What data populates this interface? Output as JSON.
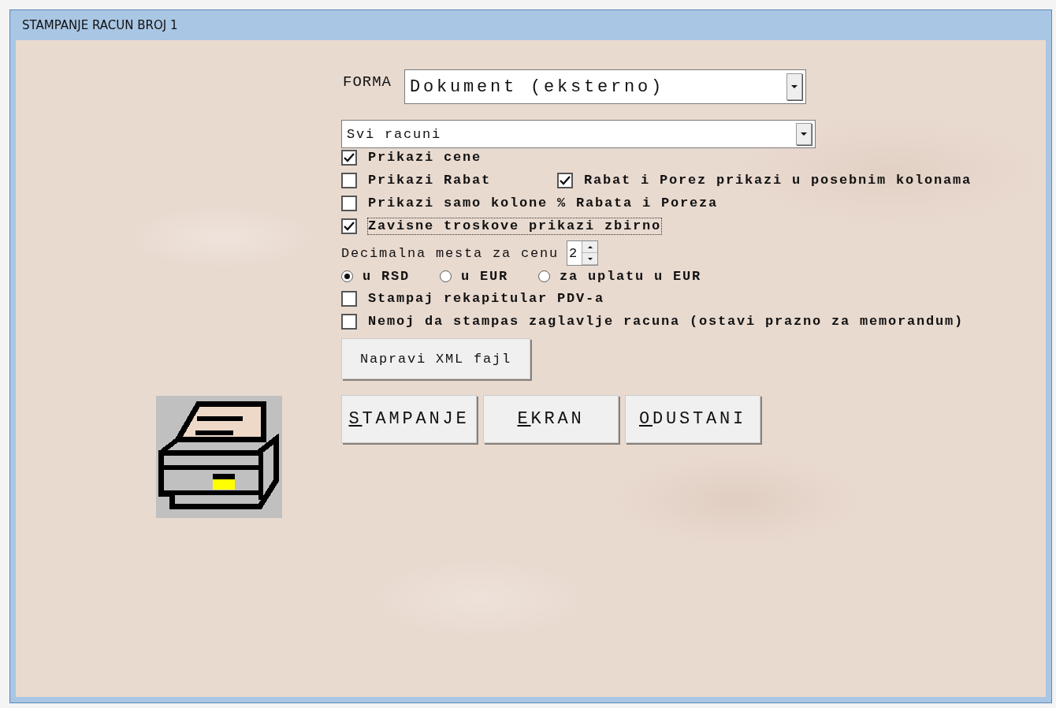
{
  "window": {
    "title": "STAMPANJE RACUN BROJ 1"
  },
  "forma": {
    "label": "FORMA",
    "value": "Dokument (eksterno)"
  },
  "filter": {
    "value": "Svi racuni"
  },
  "option_rows": [
    [
      {
        "label": "Prikazi cene",
        "checked": true,
        "focused": false
      }
    ],
    [
      {
        "label": "Prikazi Rabat",
        "checked": false,
        "focused": false
      },
      {
        "label": "Rabat i Porez prikazi u posebnim kolonama",
        "checked": true,
        "focused": false
      }
    ],
    [
      {
        "label": "Prikazi samo kolone % Rabata i Poreza",
        "checked": false,
        "focused": false
      }
    ],
    [
      {
        "label": "Zavisne troskove prikazi zbirno",
        "checked": true,
        "focused": true
      }
    ]
  ],
  "decimals": {
    "label": "Decimalna mesta za cenu",
    "value": "2"
  },
  "currency": [
    {
      "label": "u RSD",
      "selected": true
    },
    {
      "label": "u EUR",
      "selected": false
    },
    {
      "label": "za uplatu u EUR",
      "selected": false
    }
  ],
  "print_options": [
    {
      "label": "Stampaj rekapitular PDV-a",
      "checked": false
    },
    {
      "label": "Nemoj da stampas zaglavlje racuna (ostavi prazno za memorandum)",
      "checked": false
    }
  ],
  "xml_button": "Napravi XML fajl",
  "actions": [
    "STAMPANJE",
    "EKRAN",
    "ODUSTANI"
  ]
}
